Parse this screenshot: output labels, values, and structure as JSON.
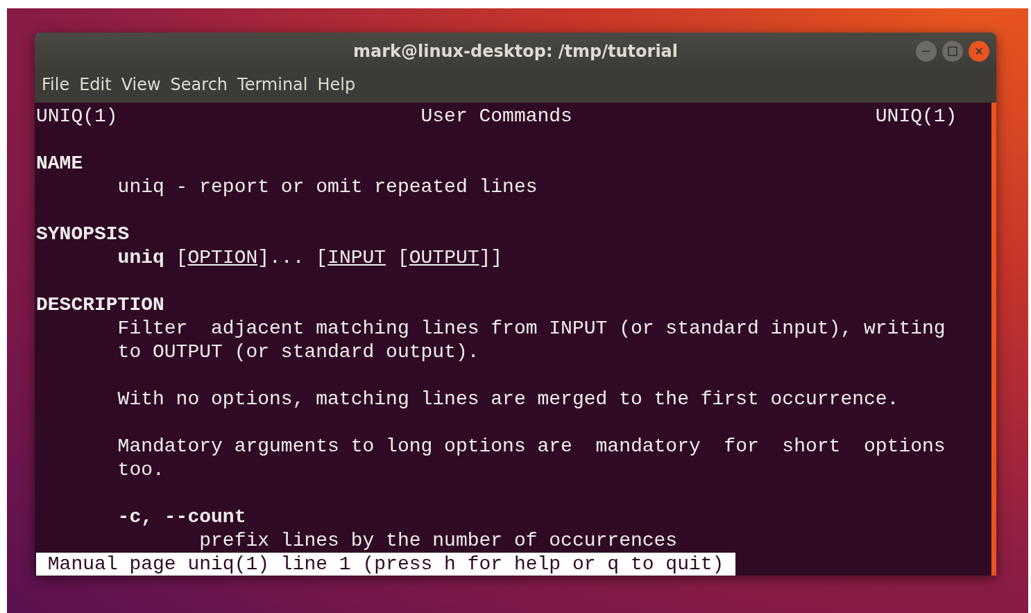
{
  "window": {
    "title": "mark@linux-desktop: /tmp/tutorial"
  },
  "menu": [
    "File",
    "Edit",
    "View",
    "Search",
    "Terminal",
    "Help"
  ],
  "man_header": {
    "left": "UNIQ(1)",
    "center": "User Commands",
    "right": "UNIQ(1)"
  },
  "lines": [
    {
      "kind": "blank"
    },
    {
      "kind": "heading",
      "text": "NAME"
    },
    {
      "kind": "body",
      "text": "uniq - report or omit repeated lines"
    },
    {
      "kind": "blank"
    },
    {
      "kind": "heading",
      "text": "SYNOPSIS"
    },
    {
      "kind": "synopsis",
      "segments": [
        {
          "kind": "command",
          "text": "uniq"
        },
        {
          "kind": "text",
          "text": " ["
        },
        {
          "kind": "argument",
          "text": "OPTION"
        },
        {
          "kind": "text",
          "text": "]... ["
        },
        {
          "kind": "argument",
          "text": "INPUT"
        },
        {
          "kind": "text",
          "text": " ["
        },
        {
          "kind": "argument",
          "text": "OUTPUT"
        },
        {
          "kind": "text",
          "text": "]]"
        }
      ]
    },
    {
      "kind": "blank"
    },
    {
      "kind": "heading",
      "text": "DESCRIPTION"
    },
    {
      "kind": "body",
      "text": "Filter  adjacent matching lines from INPUT (or standard input), writing"
    },
    {
      "kind": "body",
      "text": "to OUTPUT (or standard output)."
    },
    {
      "kind": "blank"
    },
    {
      "kind": "body",
      "text": "With no options, matching lines are merged to the first occurrence."
    },
    {
      "kind": "blank"
    },
    {
      "kind": "body",
      "text": "Mandatory arguments to long options are  mandatory  for  short  options"
    },
    {
      "kind": "body",
      "text": "too."
    },
    {
      "kind": "blank"
    },
    {
      "kind": "option",
      "text": "-c, --count"
    },
    {
      "kind": "detail",
      "text": "prefix lines by the number of occurrences"
    }
  ],
  "status_line": "Manual page uniq(1) line 1 (press h for help or q to quit)"
}
